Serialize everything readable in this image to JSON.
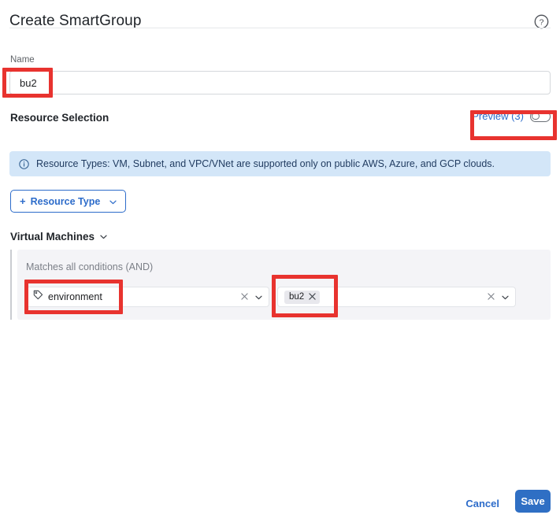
{
  "header": {
    "title": "Create SmartGroup",
    "help_icon": "help-circle-icon"
  },
  "name_field": {
    "label": "Name",
    "value": "bu2",
    "placeholder": ""
  },
  "resource_selection": {
    "title": "Resource Selection",
    "preview_label": "Preview (3)",
    "toggle_state": "off",
    "info_banner": {
      "icon": "info-circle-icon",
      "text": "Resource Types: VM, Subnet, and VPC/VNet are supported only on public AWS, Azure, and GCP clouds."
    },
    "resource_type_button": {
      "plus": "+",
      "label": "Resource Type",
      "caret": "chevron-down-icon"
    }
  },
  "virtual_machines": {
    "title": "Virtual Machines",
    "caret": "chevron-down-icon",
    "conditions_hint": "Matches all conditions (AND)",
    "key_select": {
      "icon": "tag-icon",
      "value": "environment",
      "clear_icon": "close-icon",
      "caret_icon": "chevron-down-icon"
    },
    "value_select": {
      "chips": [
        {
          "label": "bu2",
          "remove_icon": "close-icon"
        }
      ],
      "clear_icon": "close-icon",
      "caret_icon": "chevron-down-icon"
    }
  },
  "footer": {
    "cancel_label": "Cancel",
    "save_label": "Save"
  },
  "colors": {
    "accent_blue": "#2d6cca",
    "save_blue": "#2f6fc4",
    "banner_bg": "#d3e6f8",
    "banner_text": "#1f3a5f",
    "panel_bg": "#f4f4f7",
    "annotation_red": "#e8332f",
    "chip_bg": "#e8e8ed"
  },
  "annotations": [
    {
      "name": "name-input-highlight",
      "target": "name_field.value"
    },
    {
      "name": "preview-toggle-highlight",
      "target": "resource_selection.preview_label"
    },
    {
      "name": "condition-key-highlight",
      "target": "virtual_machines.key_select.value"
    },
    {
      "name": "condition-value-highlight",
      "target": "virtual_machines.value_select.chips.0.label"
    }
  ]
}
